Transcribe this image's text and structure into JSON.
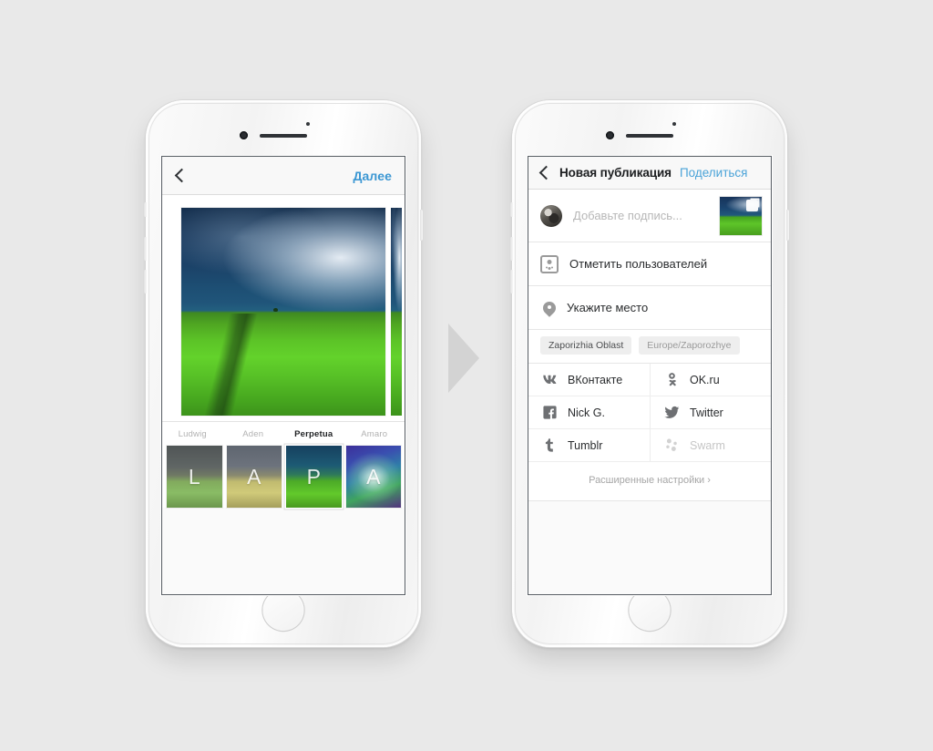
{
  "background_color": "#e9e9e9",
  "accent_color": "#3b97d3",
  "arrow": {
    "icon": "triangle-right-icon",
    "color": "#d3d3d3"
  },
  "left_phone": {
    "device": "iphone-white",
    "nav": {
      "back_icon": "chevron-left-icon",
      "next_label": "Далее"
    },
    "photo": {
      "alt": "green field under stormy blue sky",
      "peek_visible": true
    },
    "filters": [
      {
        "name": "Ludwig",
        "letter": "L",
        "selected": false
      },
      {
        "name": "Aden",
        "letter": "A",
        "selected": false
      },
      {
        "name": "Perpetua",
        "letter": "P",
        "selected": true
      },
      {
        "name": "Amaro",
        "letter": "A",
        "selected": false
      }
    ]
  },
  "right_phone": {
    "device": "iphone-white",
    "nav": {
      "back_icon": "chevron-left-icon",
      "title": "Новая публикация",
      "share_label": "Поделиться"
    },
    "caption": {
      "avatar_icon": "user-avatar",
      "placeholder": "Добавьте подпись...",
      "thumbnail_icon": "photo-thumbnail",
      "multi_badge_icon": "multiple-photos-icon"
    },
    "tag_users": {
      "icon": "id-card-icon",
      "label": "Отметить пользователей"
    },
    "location": {
      "icon": "map-pin-icon",
      "label": "Укажите место",
      "chips": [
        {
          "label": "Zaporizhia Oblast",
          "faded": false
        },
        {
          "label": "Europe/Zaporozhye",
          "faded": true
        }
      ]
    },
    "social": [
      {
        "icon": "vk-icon",
        "label": "ВКонтакте",
        "enabled": true
      },
      {
        "icon": "ok-icon",
        "label": "OK.ru",
        "enabled": true
      },
      {
        "icon": "facebook-icon",
        "label": "Nick G.",
        "enabled": true
      },
      {
        "icon": "twitter-icon",
        "label": "Twitter",
        "enabled": true
      },
      {
        "icon": "tumblr-icon",
        "label": "Tumblr",
        "enabled": true
      },
      {
        "icon": "swarm-icon",
        "label": "Swarm",
        "enabled": false
      }
    ],
    "advanced_settings_label": "Расширенные настройки ›"
  }
}
